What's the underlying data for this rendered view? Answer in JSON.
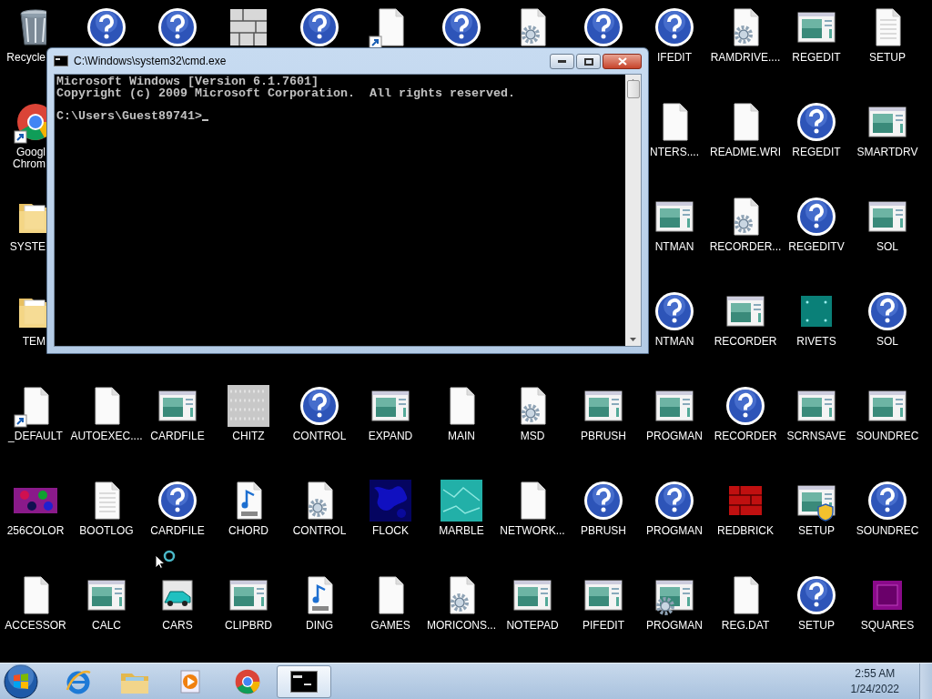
{
  "desktop": {
    "rows": [
      [
        {
          "kind": "recycle",
          "label": "Recycle",
          "clipped_right": true
        },
        {
          "kind": "help"
        },
        {
          "kind": "help"
        },
        {
          "kind": "bricks"
        },
        {
          "kind": "help"
        },
        {
          "kind": "doc",
          "shortcut": true
        },
        {
          "kind": "help"
        },
        {
          "kind": "gear-doc"
        },
        {
          "kind": "help"
        },
        {
          "kind": "help",
          "label": "IFEDIT"
        },
        {
          "kind": "gear-doc",
          "label": "RAMDRIVE...."
        },
        {
          "kind": "app",
          "label": "REGEDIT"
        },
        {
          "kind": "text-doc",
          "label": "SETUP"
        }
      ],
      [
        {
          "kind": "chrome",
          "shortcut": true,
          "label": "Googl\nChrom",
          "clipped_right": true
        },
        null,
        null,
        null,
        null,
        null,
        null,
        null,
        null,
        {
          "kind": "doc",
          "label": "NTERS...."
        },
        {
          "kind": "doc",
          "label": "README.WRI"
        },
        {
          "kind": "help",
          "label": "REGEDIT"
        },
        {
          "kind": "app",
          "label": "SMARTDRV"
        }
      ],
      [
        {
          "kind": "folder",
          "label": "SYSTE",
          "clipped_right": true
        },
        null,
        null,
        null,
        null,
        null,
        null,
        null,
        null,
        {
          "kind": "app",
          "label": "NTMAN"
        },
        {
          "kind": "gear-doc",
          "label": "RECORDER..."
        },
        {
          "kind": "help",
          "label": "REGEDITV"
        },
        {
          "kind": "app",
          "label": "SOL"
        }
      ],
      [
        {
          "kind": "folder",
          "label": "TEM",
          "clipped_right": true
        },
        null,
        null,
        null,
        null,
        null,
        null,
        null,
        null,
        {
          "kind": "help",
          "label": "NTMAN"
        },
        {
          "kind": "app",
          "label": "RECORDER"
        },
        {
          "kind": "rivets",
          "label": "RIVETS"
        },
        {
          "kind": "help",
          "label": "SOL"
        }
      ],
      [
        {
          "kind": "doc",
          "shortcut": true,
          "label": "_DEFAULT"
        },
        {
          "kind": "doc",
          "label": "AUTOEXEC...."
        },
        {
          "kind": "app",
          "label": "CARDFILE"
        },
        {
          "kind": "chitz",
          "label": "CHITZ"
        },
        {
          "kind": "help",
          "label": "CONTROL"
        },
        {
          "kind": "app",
          "label": "EXPAND"
        },
        {
          "kind": "doc",
          "label": "MAIN"
        },
        {
          "kind": "gear-doc",
          "label": "MSD"
        },
        {
          "kind": "app",
          "label": "PBRUSH"
        },
        {
          "kind": "app",
          "label": "PROGMAN"
        },
        {
          "kind": "help",
          "label": "RECORDER"
        },
        {
          "kind": "app",
          "label": "SCRNSAVE"
        },
        {
          "kind": "app",
          "label": "SOUNDREC"
        }
      ],
      [
        {
          "kind": "color256",
          "label": "256COLOR"
        },
        {
          "kind": "text-doc",
          "label": "BOOTLOG"
        },
        {
          "kind": "help",
          "label": "CARDFILE"
        },
        {
          "kind": "wav",
          "label": "CHORD"
        },
        {
          "kind": "gear-doc",
          "label": "CONTROL"
        },
        {
          "kind": "flock",
          "label": "FLOCK"
        },
        {
          "kind": "marble",
          "label": "MARBLE"
        },
        {
          "kind": "doc",
          "label": "NETWORK..."
        },
        {
          "kind": "help",
          "label": "PBRUSH"
        },
        {
          "kind": "help",
          "label": "PROGMAN"
        },
        {
          "kind": "redbrick",
          "label": "REDBRICK"
        },
        {
          "kind": "setup",
          "label": "SETUP"
        },
        {
          "kind": "help",
          "label": "SOUNDREC"
        }
      ],
      [
        {
          "kind": "doc",
          "label": "ACCESSOR"
        },
        {
          "kind": "app",
          "label": "CALC"
        },
        {
          "kind": "cars",
          "label": "CARS"
        },
        {
          "kind": "app",
          "label": "CLIPBRD"
        },
        {
          "kind": "wav",
          "label": "DING"
        },
        {
          "kind": "doc",
          "label": "GAMES"
        },
        {
          "kind": "gear-doc",
          "label": "MORICONS..."
        },
        {
          "kind": "app",
          "label": "NOTEPAD"
        },
        {
          "kind": "app",
          "label": "PIFEDIT"
        },
        {
          "kind": "app-gear",
          "label": "PROGMAN"
        },
        {
          "kind": "doc",
          "label": "REG.DAT"
        },
        {
          "kind": "help",
          "label": "SETUP"
        },
        {
          "kind": "squares",
          "label": "SQUARES"
        }
      ]
    ]
  },
  "window": {
    "title": "C:\\Windows\\system32\\cmd.exe",
    "output": [
      "Microsoft Windows [Version 6.1.7601]",
      "Copyright (c) 2009 Microsoft Corporation.  All rights reserved."
    ],
    "prompt": "C:\\Users\\Guest89741>"
  },
  "taskbar": {
    "items": [
      {
        "kind": "ie",
        "selected": false
      },
      {
        "kind": "explorer",
        "selected": false
      },
      {
        "kind": "media",
        "selected": false
      },
      {
        "kind": "chrome",
        "selected": false
      },
      {
        "kind": "cmd",
        "selected": true
      }
    ],
    "time": "2:55 AM",
    "date": "1/24/2022"
  }
}
